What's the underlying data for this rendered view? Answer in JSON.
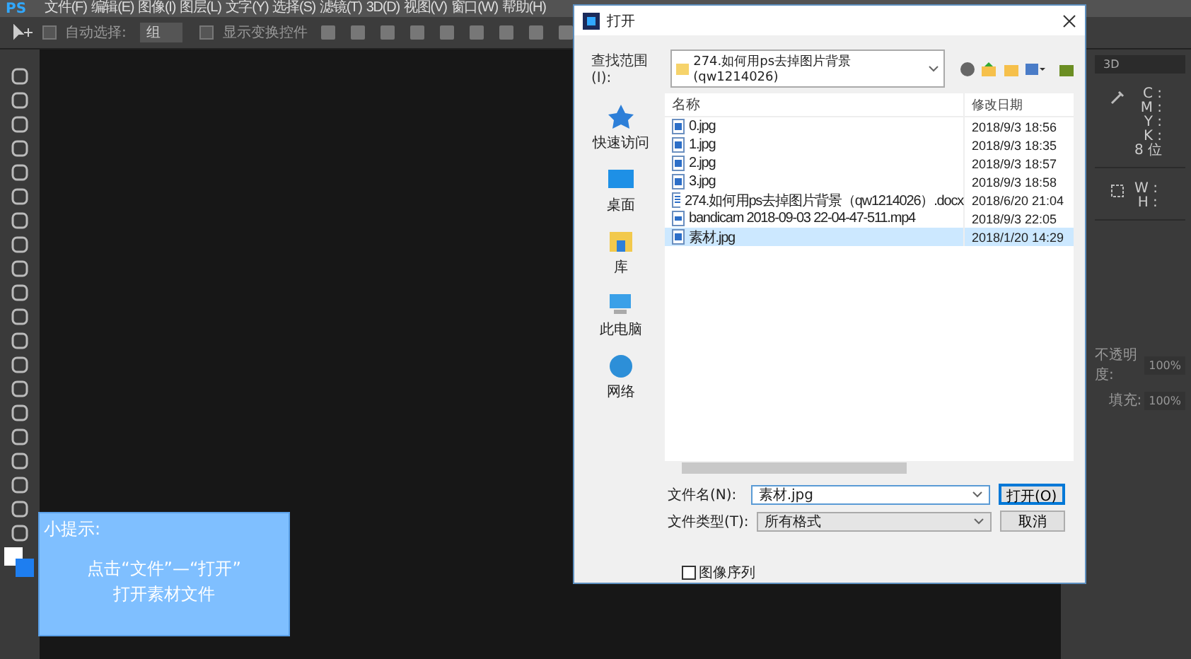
{
  "menu_bar": {
    "logo": "PS",
    "items": [
      "文件(F)",
      "编辑(E)",
      "图像(I)",
      "图层(L)",
      "文字(Y)",
      "选择(S)",
      "滤镜(T)",
      "3D(D)",
      "视图(V)",
      "窗口(W)",
      "帮助(H)"
    ]
  },
  "options_bar": {
    "auto_select": {
      "label": "自动选择:",
      "checked": false,
      "value": "组"
    },
    "show_transform": {
      "label": "显示变换控件",
      "checked": false
    }
  },
  "right_panel": {
    "workspace": "3D",
    "info_labels": [
      "C :",
      "M :",
      "Y :",
      "K :",
      "8 位"
    ],
    "size_labels": [
      "W :",
      "H :"
    ],
    "opacity": {
      "label": "不透明度:",
      "value": "100%"
    },
    "fill": {
      "label": "填充:",
      "value": "100%"
    }
  },
  "dialog": {
    "title": "打开",
    "look_in_label": "查找范围(I):",
    "look_in": "274.如何用ps去掉图片背景(qw1214026)",
    "places": [
      {
        "label": "快速访问",
        "kind": "star"
      },
      {
        "label": "桌面",
        "kind": "desktop"
      },
      {
        "label": "库",
        "kind": "library"
      },
      {
        "label": "此电脑",
        "kind": "computer"
      },
      {
        "label": "网络",
        "kind": "network"
      }
    ],
    "columns": [
      "名称",
      "修改日期"
    ],
    "files": [
      {
        "name": "0.jpg",
        "date": "2018/9/3 18:56",
        "kind": "image",
        "selected": false
      },
      {
        "name": "1.jpg",
        "date": "2018/9/3 18:35",
        "kind": "image",
        "selected": false
      },
      {
        "name": "2.jpg",
        "date": "2018/9/3 18:57",
        "kind": "image",
        "selected": false
      },
      {
        "name": "3.jpg",
        "date": "2018/9/3 18:58",
        "kind": "image",
        "selected": false
      },
      {
        "name": "274.如何用ps去掉图片背景（qw1214026）.docx",
        "date": "2018/6/20 21:04",
        "kind": "doc",
        "selected": false
      },
      {
        "name": "bandicam 2018-09-03 22-04-47-511.mp4",
        "date": "2018/9/3 22:05",
        "kind": "video",
        "selected": false
      },
      {
        "name": "素材.jpg",
        "date": "2018/1/20 14:29",
        "kind": "image",
        "selected": true
      }
    ],
    "file_name_label": "文件名(N):",
    "file_name": "素材.jpg",
    "file_type_label": "文件类型(T):",
    "file_type": "所有格式",
    "buttons": [
      "打开(O)",
      "取消"
    ],
    "image_sequence": {
      "label": "图像序列",
      "checked": false
    }
  },
  "tip": {
    "title": "小提示:",
    "lines": [
      "点击“文件”—“打开”",
      "打开素材文件"
    ]
  }
}
